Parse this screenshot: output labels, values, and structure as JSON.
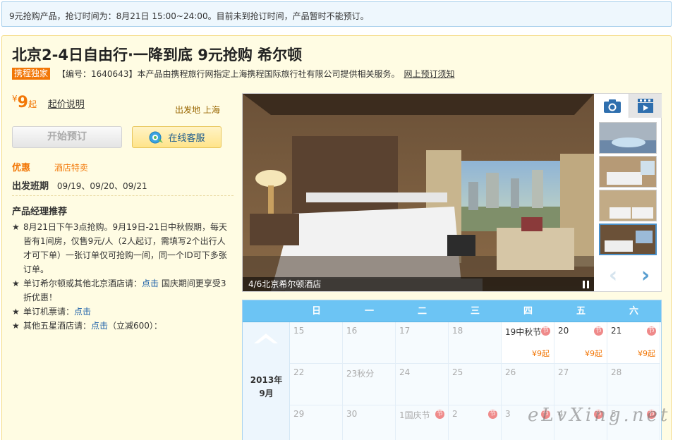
{
  "notice": "9元抢购产品，抢订时间为：8月21日 15:00~24:00。目前未到抢订时间，产品暂时不能预订。",
  "product": {
    "title": "北京2-4日自由行·一降到底 9元抢购 希尔顿",
    "badge": "携程独家",
    "meta_text": "【编号：1640643】本产品由携程旅行网指定上海携程国际旅行社有限公司提供相关服务。",
    "notice_link": "网上预订须知"
  },
  "price": {
    "currency": "¥",
    "amount": "9",
    "unit": "起",
    "explain": "起价说明"
  },
  "departure": "出发地 上海",
  "buttons": {
    "book": "开始预订",
    "chat": "在线客服"
  },
  "promo": {
    "label": "优惠",
    "value": "酒店特卖"
  },
  "dates": {
    "label": "出发班期",
    "value": "09/19、09/20、09/21"
  },
  "recommend": {
    "title": "产品经理推荐",
    "items": [
      {
        "star": "★",
        "text": "8月21日下午3点抢购。9月19日-21日中秋假期，每天皆有1间房，仅售9元/人（2人起订，需填写2个出行人才可下单）一张订单仅可抢购一间，同一个ID可下多张订单。",
        "link": "",
        "tail": ""
      },
      {
        "star": "★",
        "text": "单订希尔顿或其他北京酒店请：",
        "link": "点击",
        "tail": " 国庆期间更享受3折优惠！"
      },
      {
        "star": "★",
        "text": "单订机票请：",
        "link": "点击",
        "tail": ""
      },
      {
        "star": "★",
        "text": "其他五星酒店请：",
        "link": "点击",
        "tail": "（立减600）："
      }
    ]
  },
  "gallery": {
    "caption": "4/6北京希尔顿酒店",
    "thumb_count": 4,
    "active_thumb": 3
  },
  "calendar": {
    "weekdays": [
      "日",
      "一",
      "二",
      "三",
      "四",
      "五",
      "六"
    ],
    "year": "2013年",
    "month": "9月",
    "holiday_mark": "节",
    "rows": [
      [
        {
          "d": "15"
        },
        {
          "d": "16"
        },
        {
          "d": "17"
        },
        {
          "d": "18"
        },
        {
          "d": "19中秋节",
          "holiday": true,
          "price": "¥9起"
        },
        {
          "d": "20",
          "holiday": true,
          "price": "¥9起"
        },
        {
          "d": "21",
          "holiday": true,
          "price": "¥9起"
        }
      ],
      [
        {
          "d": "22"
        },
        {
          "d": "23秋分"
        },
        {
          "d": "24"
        },
        {
          "d": "25"
        },
        {
          "d": "26"
        },
        {
          "d": "27"
        },
        {
          "d": "28"
        }
      ],
      [
        {
          "d": "29"
        },
        {
          "d": "30"
        },
        {
          "d": "1国庆节",
          "holiday": true
        },
        {
          "d": "2",
          "holiday": true
        },
        {
          "d": "3",
          "holiday": true
        },
        {
          "d": "4",
          "holiday": true
        },
        {
          "d": "5",
          "holiday": true
        }
      ]
    ]
  },
  "watermark": "eLvXing.net",
  "colors": {
    "accent": "#f27707",
    "calendar_header": "#6cc4f4",
    "link": "#1a5ea8",
    "panel_bg": "#fffce3"
  }
}
